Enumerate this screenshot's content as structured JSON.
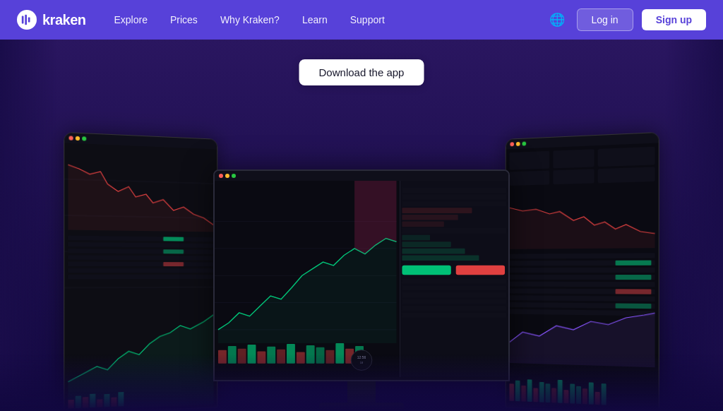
{
  "navbar": {
    "logo_text": "kraken",
    "nav_links": [
      {
        "label": "Explore",
        "id": "explore"
      },
      {
        "label": "Prices",
        "id": "prices"
      },
      {
        "label": "Why Kraken?",
        "id": "why-kraken"
      },
      {
        "label": "Learn",
        "id": "learn"
      },
      {
        "label": "Support",
        "id": "support"
      }
    ],
    "login_label": "Log in",
    "signup_label": "Sign up"
  },
  "hero": {
    "download_btn_label": "Download the app"
  },
  "colors": {
    "navbar_bg": "#5741d9",
    "hero_bg": "#2a1660",
    "green": "#00c076",
    "red": "#e04040",
    "accent": "#5741d9"
  }
}
